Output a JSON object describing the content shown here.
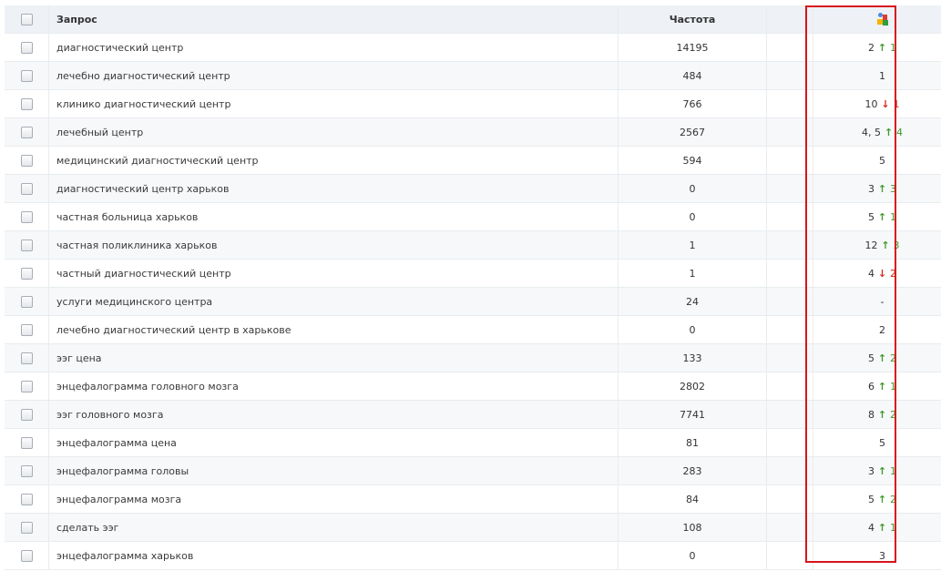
{
  "header": {
    "query_label": "Запрос",
    "freq_label": "Частота",
    "engine_icon": "google-icon"
  },
  "colors": {
    "up": "#3e9a2a",
    "down": "#d22a1e",
    "highlight": "#d8141c"
  },
  "rows": [
    {
      "query": "диагностический центр",
      "freq": "14195",
      "pos": "2",
      "dir": "up",
      "chg": "1"
    },
    {
      "query": "лечебно диагностический центр",
      "freq": "484",
      "pos": "1",
      "dir": "",
      "chg": ""
    },
    {
      "query": "клинико диагностический центр",
      "freq": "766",
      "pos": "10",
      "dir": "down",
      "chg": "1"
    },
    {
      "query": "лечебный центр",
      "freq": "2567",
      "pos": "4, 5",
      "dir": "up",
      "chg": "4"
    },
    {
      "query": "медицинский диагностический центр",
      "freq": "594",
      "pos": "5",
      "dir": "",
      "chg": ""
    },
    {
      "query": "диагностический центр харьков",
      "freq": "0",
      "pos": "3",
      "dir": "up",
      "chg": "3"
    },
    {
      "query": "частная больница харьков",
      "freq": "0",
      "pos": "5",
      "dir": "up",
      "chg": "1"
    },
    {
      "query": "частная поликлиника харьков",
      "freq": "1",
      "pos": "12",
      "dir": "up",
      "chg": "3"
    },
    {
      "query": "частный диагностический центр",
      "freq": "1",
      "pos": "4",
      "dir": "down",
      "chg": "2"
    },
    {
      "query": "услуги медицинского центра",
      "freq": "24",
      "pos": "-",
      "dir": "",
      "chg": ""
    },
    {
      "query": "лечебно диагностический центр в харькове",
      "freq": "0",
      "pos": "2",
      "dir": "",
      "chg": ""
    },
    {
      "query": "ээг цена",
      "freq": "133",
      "pos": "5",
      "dir": "up",
      "chg": "2"
    },
    {
      "query": "энцефалограмма головного мозга",
      "freq": "2802",
      "pos": "6",
      "dir": "up",
      "chg": "1"
    },
    {
      "query": "ээг головного мозга",
      "freq": "7741",
      "pos": "8",
      "dir": "up",
      "chg": "2"
    },
    {
      "query": "энцефалограмма цена",
      "freq": "81",
      "pos": "5",
      "dir": "",
      "chg": ""
    },
    {
      "query": "энцефалограмма головы",
      "freq": "283",
      "pos": "3",
      "dir": "up",
      "chg": "1"
    },
    {
      "query": "энцефалограмма мозга",
      "freq": "84",
      "pos": "5",
      "dir": "up",
      "chg": "2"
    },
    {
      "query": "сделать ээг",
      "freq": "108",
      "pos": "4",
      "dir": "up",
      "chg": "1"
    },
    {
      "query": "энцефалограмма харьков",
      "freq": "0",
      "pos": "3",
      "dir": "",
      "chg": ""
    }
  ]
}
